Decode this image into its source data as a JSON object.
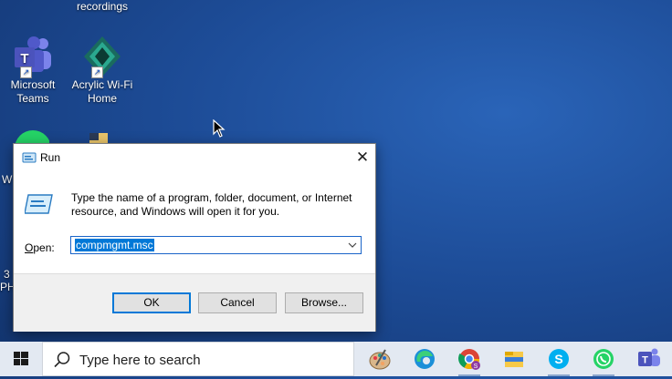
{
  "desktop": {
    "icons": [
      {
        "label": "recordings"
      },
      {
        "label": "Microsoft Teams"
      },
      {
        "label": "Acrylic Wi-Fi Home"
      }
    ],
    "partial_labels": [
      "W",
      "3",
      "PH"
    ]
  },
  "run_dialog": {
    "title": "Run",
    "message": "Type the name of a program, folder, document, or Internet resource, and Windows will open it for you.",
    "open_label_prefix": "",
    "open_label_mnemonic": "O",
    "open_label_rest": "pen:",
    "open_value": "compmgmt.msc",
    "buttons": {
      "ok": "OK",
      "cancel": "Cancel",
      "browse": "Browse..."
    },
    "close_glyph": "✕"
  },
  "taskbar": {
    "search_placeholder": "Type here to search",
    "apps": [
      "paint-icon",
      "edge-icon",
      "chrome-icon",
      "file-explorer-icon",
      "skype-icon",
      "whatsapp-icon",
      "teams-icon"
    ]
  },
  "colors": {
    "desktop": "#1d4c97",
    "accent": "#0078d7",
    "taskbar": "#e3e9f2"
  }
}
